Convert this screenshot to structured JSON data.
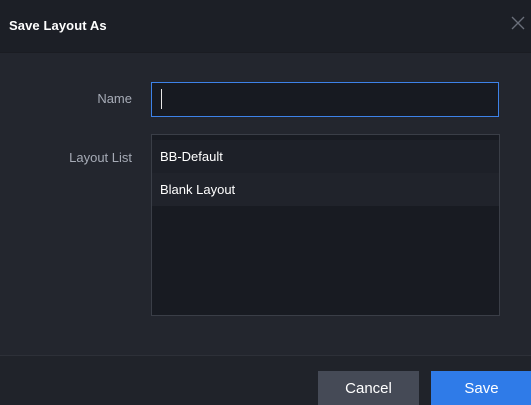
{
  "dialog": {
    "title": "Save Layout As",
    "close_icon": "close-icon"
  },
  "form": {
    "name_label": "Name",
    "name_value": "",
    "layout_list_label": "Layout List"
  },
  "layout_list": {
    "items": [
      {
        "label": "BB-Default"
      },
      {
        "label": "Blank Layout"
      }
    ]
  },
  "buttons": {
    "cancel_label": "Cancel",
    "save_label": "Save"
  },
  "colors": {
    "accent": "#2f7be8",
    "background": "#23262e",
    "titlebar": "#1c1f26"
  }
}
